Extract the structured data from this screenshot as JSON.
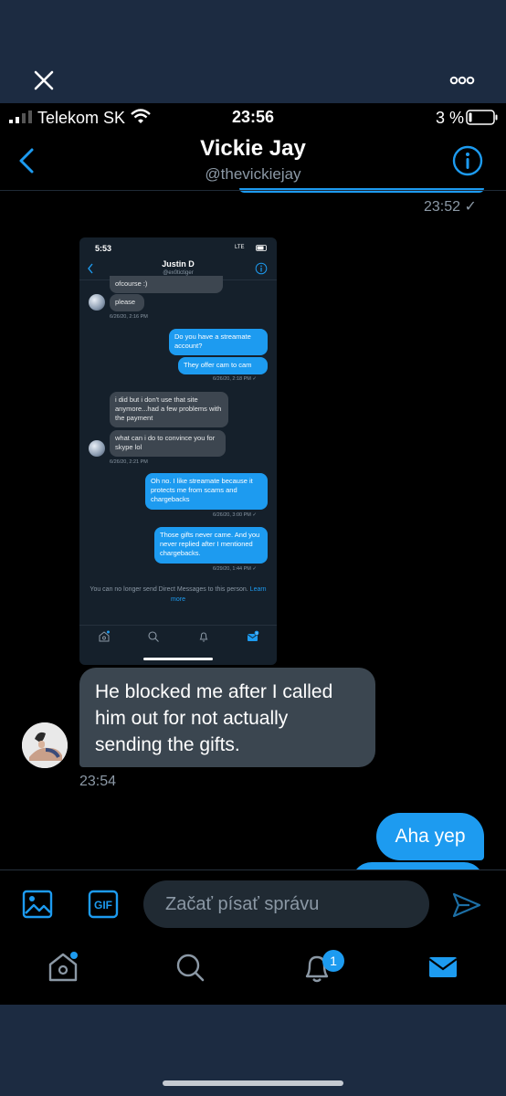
{
  "status_bar": {
    "carrier": "Telekom SK",
    "time": "23:56",
    "battery": "3 %"
  },
  "header": {
    "title": "Vickie Jay",
    "handle": "@thevickiejay"
  },
  "messages": {
    "top_time": "23:52 ✓",
    "received_text": "He blocked me after I called him out for not actually sending the gifts.",
    "received_time": "23:54",
    "sent_text": "Aha yep"
  },
  "screenshot": {
    "time": "5:53",
    "network": "LTE",
    "title": "Justin D",
    "handle": "@ex0tictiger",
    "msg1": "ofcourse :)",
    "msg2": "please",
    "ts1": "6/26/20, 2:16 PM",
    "msg3": "Do you have a streamate account?",
    "msg4": "They offer cam to cam",
    "ts2": "6/26/20, 2:18 PM ✓",
    "msg5": "i did but i don't use that site anymore...had a few problems with the payment",
    "msg6": "what can i do to convince you for skype lol",
    "ts3": "6/26/20, 2:21 PM",
    "msg7": "Oh no. I like streamate because it protects me from scams and chargebacks",
    "ts4": "6/26/20, 3:00 PM ✓",
    "msg8": "Those gifts never came. And you never replied after I mentioned chargebacks.",
    "ts5": "6/29/20, 1:44 PM ✓",
    "note": "You can no longer send Direct Messages to this person.",
    "note_link": "Learn more",
    "badge": "1"
  },
  "composer": {
    "placeholder": "Začať písať správu",
    "gif_label": "GIF"
  },
  "tabbar": {
    "notification_badge": "1"
  },
  "colors": {
    "accent": "#1d9bf0",
    "bubble_in": "#3b4650",
    "background": "#000000",
    "viewer_chrome": "#1c2b41"
  }
}
